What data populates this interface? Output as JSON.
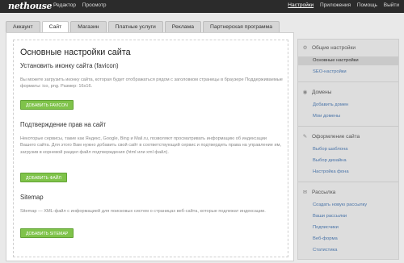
{
  "top_nav": {
    "logo": "nethouse",
    "left": [
      "Редактор",
      "Просмотр"
    ],
    "right": [
      "Настройки",
      "Приложения",
      "Помощь",
      "Выйти"
    ],
    "right_active_index": 0
  },
  "tabs": [
    "Аккаунт",
    "Сайт",
    "Магазин",
    "Платные услуги",
    "Реклама",
    "Партнерская программа"
  ],
  "active_tab_index": 1,
  "main": {
    "title": "Основные настройки сайта",
    "favicon": {
      "heading": "Установить иконку сайта (favicon)",
      "text": "Вы можете загрузить иконку сайта, которая будет отображаться рядом с заголовком страницы в браузере Поддерживаемые форматы: ico, png. Размер: 16х16.",
      "button": "ДОБАВИТЬ FAVICON"
    },
    "verification": {
      "heading": "Подтверждение прав на сайт",
      "text": "Некоторые сервисы, такие как Яндекс, Google, Bing и Mail.ru, позволяют просматривать информацию об индексации Вашего сайта. Для этого Вам нужно добавить свой сайт в соответствующий сервис и подтвердить права на управление им, загрузив в корневой раздел файл подтверждения (html или xml файл).",
      "button": "ДОБАВИТЬ ФАЙЛ"
    },
    "sitemap": {
      "heading": "Sitemap",
      "text": "Sitemap — XML-файл с информацией для поисковых систем о страницах веб-сайта, которые подлежат индексации.",
      "button": "ДОБАВИТЬ SITEMAP"
    }
  },
  "sidebar": {
    "sections": [
      {
        "title": "Общие настройки",
        "icon": "gear-icon",
        "items": [
          "Основные настройки",
          "SEO-настройки"
        ],
        "active_index": 0
      },
      {
        "title": "Домены",
        "icon": "globe-icon",
        "items": [
          "Добавить домен",
          "Мои домены"
        ]
      },
      {
        "title": "Оформление сайта",
        "icon": "pencil-icon",
        "items": [
          "Выбор шаблона",
          "Выбор дизайна",
          "Настройка фона"
        ]
      },
      {
        "title": "Рассылка",
        "icon": "envelope-icon",
        "items": [
          "Создать новую рассылку",
          "Ваши рассылки",
          "Подписчики",
          "Веб-форма",
          "Статистика"
        ]
      }
    ]
  }
}
